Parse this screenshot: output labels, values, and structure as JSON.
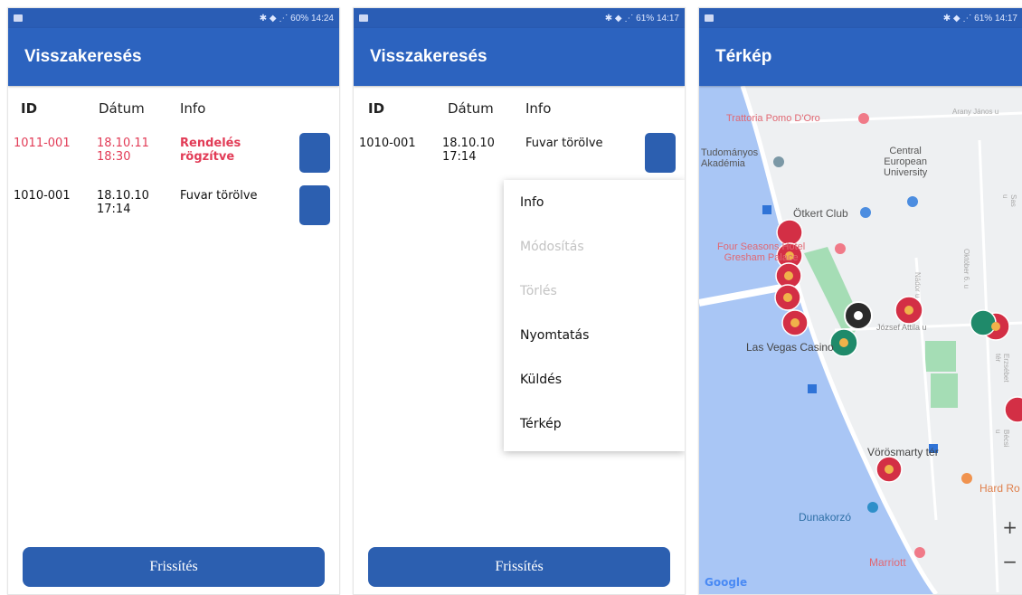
{
  "status_bars": [
    {
      "icons": "✱ ◆ ⋰",
      "battery": "60%",
      "time": "14:24"
    },
    {
      "icons": "✱ ◆ ⋰",
      "battery": "61%",
      "time": "14:17"
    },
    {
      "icons": "✱ ◆ ⋰",
      "battery": "61%",
      "time": "14:17"
    }
  ],
  "screen1": {
    "title": "Visszakeresés",
    "headers": {
      "id": "ID",
      "date": "Dátum",
      "info": "Info"
    },
    "rows": [
      {
        "id": "1011-001",
        "date": "18.10.11\n18:30",
        "info": "Rendelés\nrögzítve"
      },
      {
        "id": "1010-001",
        "date": "18.10.10\n17:14",
        "info": "Fuvar törölve"
      }
    ],
    "refresh_label": "Frissítés"
  },
  "screen2": {
    "title": "Visszakeresés",
    "headers": {
      "id": "ID",
      "date": "Dátum",
      "info": "Info"
    },
    "rows": [
      {
        "id": "1010-001",
        "date": "18.10.10\n17:14",
        "info": "Fuvar törölve"
      }
    ],
    "menu": [
      "Info",
      "Módosítás",
      "Törlés",
      "Nyomtatás",
      "Küldés",
      "Térkép"
    ],
    "menu_disabled": [
      false,
      true,
      true,
      false,
      false,
      false
    ],
    "refresh_label": "Frissítés"
  },
  "screen3": {
    "title": "Térkép",
    "labels": {
      "trattoria": "Trattoria Pomo D'Oro",
      "akademia": "Tudományos\nAkadémia",
      "ceu": "Central\nEuropean\nUniversity",
      "otkert": "Ötkert Club",
      "fourseasons": "Four Seasons Hotel\nGresham Palace",
      "lasvegas": "Las Vegas Casino",
      "jozsef": "József Attila u",
      "vorosmarty": "Vörösmarty tér",
      "hardrock": "Hard Ro",
      "dunakorzo": "Dunakorzó",
      "marriott": "Marriott",
      "arany": "Arany János u",
      "oktober": "Október 6. u",
      "nador": "Nádor u",
      "erzsebet": "Erzsébet tér",
      "becsi": "Bécsi u",
      "sas": "Sas u"
    },
    "google_text": "Google",
    "zoom_in": "+",
    "zoom_out": "−",
    "colors": {
      "water": "#a9c6f5",
      "park": "#a5ddb5",
      "road": "#ffffff",
      "land": "#eef0f2",
      "pin_red": "#d32f45",
      "pin_green": "#1f8a6a"
    }
  }
}
